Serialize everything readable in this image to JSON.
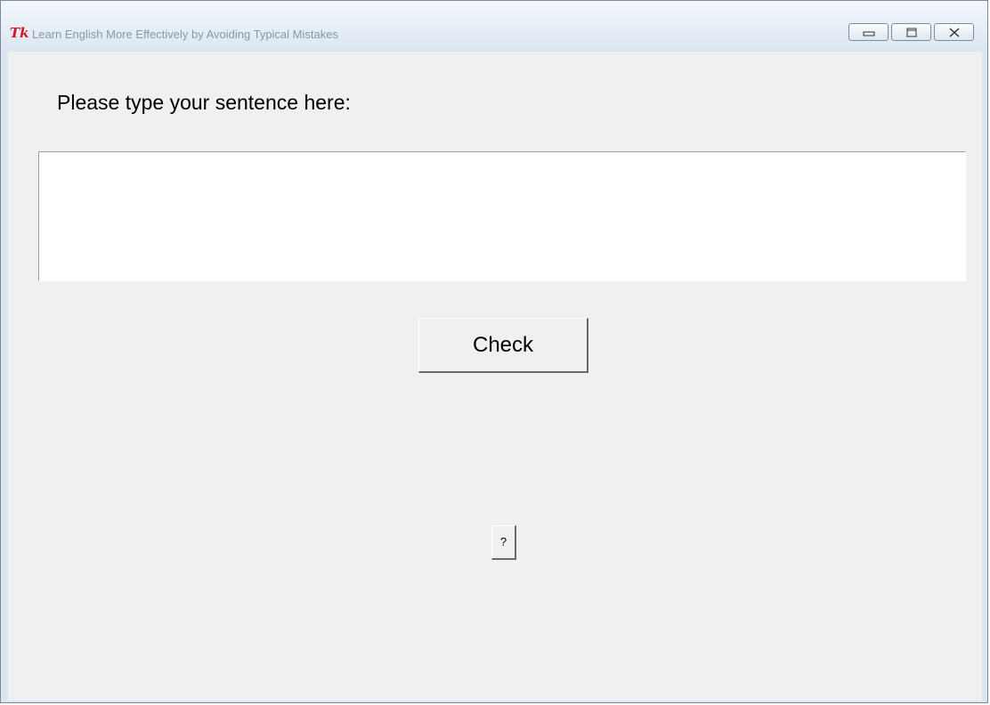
{
  "window": {
    "title": "Learn English More Effectively by Avoiding Typical Mistakes",
    "app_icon_text": "Tk",
    "controls": [
      "minimize",
      "maximize",
      "close"
    ]
  },
  "main": {
    "prompt_label": "Please type your sentence here:",
    "sentence_input": {
      "value": "",
      "placeholder": ""
    },
    "check_button_label": "Check",
    "help_button_label": "?"
  },
  "colors": {
    "titlebar": "#dde8f3",
    "client_background": "#f0f0f0",
    "input_background": "#ffffff",
    "tk_icon": "#d4141c"
  },
  "icons": [
    "tk-app-icon",
    "minimize-icon",
    "maximize-icon",
    "close-icon"
  ]
}
